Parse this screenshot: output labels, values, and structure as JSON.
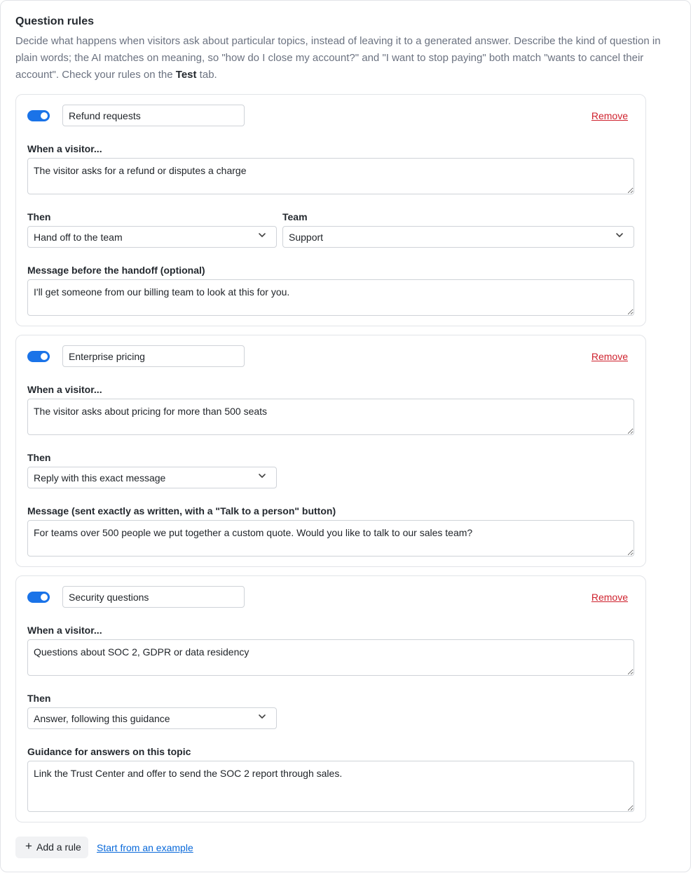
{
  "header": {
    "title": "Question rules",
    "description_1": "Decide what happens when visitors ask about particular topics, instead of leaving it to a generated answer. Describe the kind of question in plain words; the AI matches on meaning, so \"how do I close my account?\" and \"I want to stop paying\" both match \"wants to cancel their account\". Check your rules on the ",
    "description_bold": "Test",
    "description_2": " tab."
  },
  "remove_label": "Remove",
  "rules": [
    {
      "enabled": true,
      "name": "Refund requests",
      "when_label": "When a visitor...",
      "when_value": "The visitor asks for a refund or disputes a charge",
      "then_label": "Then",
      "then_value": "Hand off to the team",
      "team_label": "Team",
      "team_value": "Support",
      "message_label": "Message before the handoff (optional)",
      "message_value": "I'll get someone from our billing team to look at this for you."
    },
    {
      "enabled": true,
      "name": "Enterprise pricing",
      "when_label": "When a visitor...",
      "when_value": "The visitor asks about pricing for more than 500 seats",
      "then_label": "Then",
      "then_value": "Reply with this exact message",
      "message_label": "Message (sent exactly as written, with a \"Talk to a person\" button)",
      "message_value": "For teams over 500 people we put together a custom quote. Would you like to talk to our sales team?"
    },
    {
      "enabled": true,
      "name": "Security questions",
      "when_label": "When a visitor...",
      "when_value": "Questions about SOC 2, GDPR or data residency",
      "then_label": "Then",
      "then_value": "Answer, following this guidance",
      "message_label": "Guidance for answers on this topic",
      "message_value": "Link the Trust Center and offer to send the SOC 2 report through sales."
    }
  ],
  "footer": {
    "add_rule_label": "Add a rule",
    "example_link_label": "Start from an example"
  },
  "colors": {
    "toggle_on": "#1a73e8",
    "remove": "#cf222e",
    "link": "#0969da"
  }
}
